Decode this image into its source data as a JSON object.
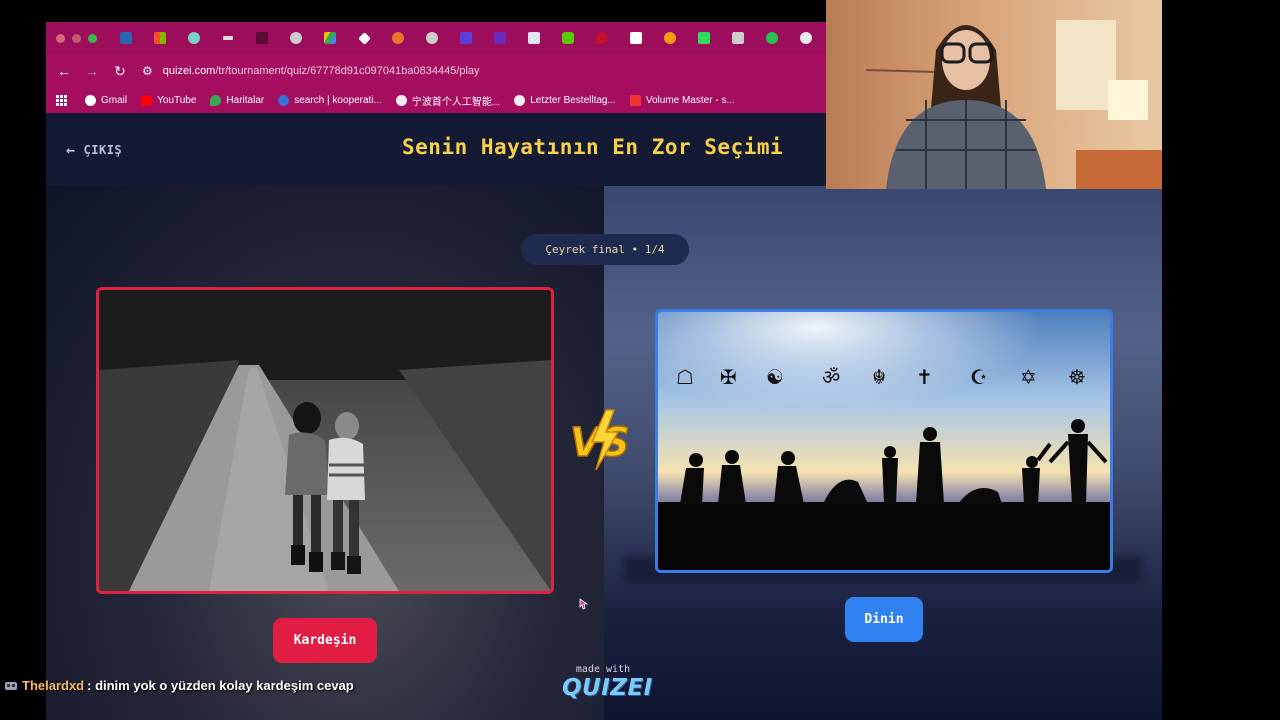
{
  "browser": {
    "url_host": "quizei.com",
    "url_path": "/tr/tournament/quiz/67778d91c097041ba0834445/play",
    "bookmarks": [
      "Gmail",
      "YouTube",
      "Haritalar",
      "search | kooperati...",
      "宁波首个人工智能...",
      "Letzter Bestelltag...",
      "Volume Master - s..."
    ]
  },
  "page": {
    "exit_label": "ÇIKIŞ",
    "title": "Senin Hayatının En Zor Seçimi",
    "round_label": "Çeyrek final • 1/4",
    "left_choice": "Kardeşin",
    "right_choice": "Dinin",
    "made_with": "made with",
    "brand": "QUIZEI"
  },
  "chat": {
    "username": "Thelardxd",
    "message": ": dinim yok o yüzden kolay kardeşim cevap"
  },
  "colors": {
    "title": "#f7d14a",
    "left_accent": "#e21d44",
    "right_accent": "#2f82f0",
    "tabbar": "#9c0d5c"
  }
}
